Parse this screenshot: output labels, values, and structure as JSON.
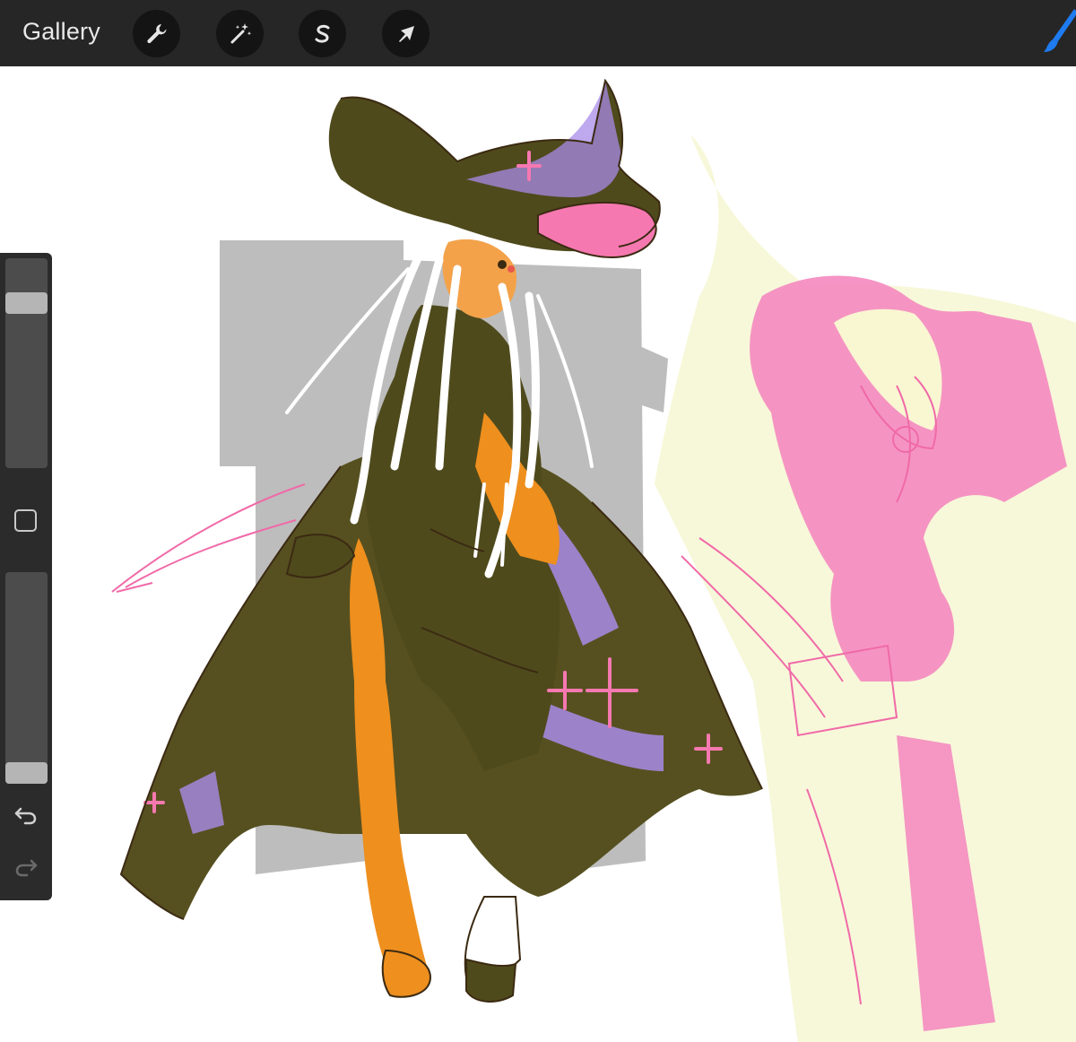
{
  "toolbar": {
    "gallery_label": "Gallery",
    "tools": [
      "wrench-icon",
      "magic-wand-icon",
      "selection-s-icon",
      "transform-arrow-icon"
    ],
    "active_tool": "brush-icon",
    "accent_color": "#1e7bf0"
  },
  "sidebar": {
    "brush_size_level": 0.82,
    "opacity_level": 0.0,
    "undo_icon": "undo-icon",
    "redo_icon": "redo-icon"
  },
  "canvas": {
    "background": "#ffffff",
    "colors": {
      "cloak": "#4f4a1c",
      "lavender": "#a98be9",
      "pink": "#f678b0",
      "orange": "#ee8f1e",
      "gray_block": "#bdbdbd",
      "pale_yellow": "#f6f7d8",
      "line": "#3b2a12"
    }
  }
}
